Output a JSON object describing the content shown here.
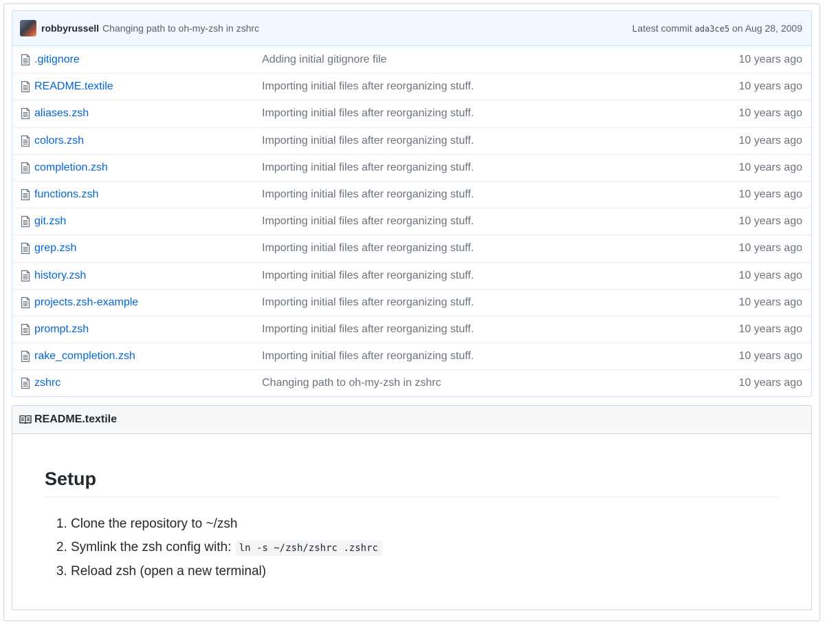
{
  "commit": {
    "author": "robbyrussell",
    "message": "Changing path to oh-my-zsh in zshrc",
    "latest_prefix": "Latest commit",
    "sha": "ada3ce5",
    "date_text": "on Aug 28, 2009"
  },
  "files": [
    {
      "name": ".gitignore",
      "message": "Adding initial gitignore file",
      "age": "10 years ago"
    },
    {
      "name": "README.textile",
      "message": "Importing initial files after reorganizing stuff.",
      "age": "10 years ago"
    },
    {
      "name": "aliases.zsh",
      "message": "Importing initial files after reorganizing stuff.",
      "age": "10 years ago"
    },
    {
      "name": "colors.zsh",
      "message": "Importing initial files after reorganizing stuff.",
      "age": "10 years ago"
    },
    {
      "name": "completion.zsh",
      "message": "Importing initial files after reorganizing stuff.",
      "age": "10 years ago"
    },
    {
      "name": "functions.zsh",
      "message": "Importing initial files after reorganizing stuff.",
      "age": "10 years ago"
    },
    {
      "name": "git.zsh",
      "message": "Importing initial files after reorganizing stuff.",
      "age": "10 years ago"
    },
    {
      "name": "grep.zsh",
      "message": "Importing initial files after reorganizing stuff.",
      "age": "10 years ago"
    },
    {
      "name": "history.zsh",
      "message": "Importing initial files after reorganizing stuff.",
      "age": "10 years ago"
    },
    {
      "name": "projects.zsh-example",
      "message": "Importing initial files after reorganizing stuff.",
      "age": "10 years ago"
    },
    {
      "name": "prompt.zsh",
      "message": "Importing initial files after reorganizing stuff.",
      "age": "10 years ago"
    },
    {
      "name": "rake_completion.zsh",
      "message": "Importing initial files after reorganizing stuff.",
      "age": "10 years ago"
    },
    {
      "name": "zshrc",
      "message": "Changing path to oh-my-zsh in zshrc",
      "age": "10 years ago"
    }
  ],
  "readme": {
    "filename": "README.textile",
    "title": "Setup",
    "steps": [
      {
        "text": "Clone the repository to ~/zsh",
        "code": ""
      },
      {
        "text": "Symlink the zsh config with: ",
        "code": "ln -s ~/zsh/zshrc .zshrc"
      },
      {
        "text": "Reload zsh (open a new terminal)",
        "code": ""
      }
    ]
  },
  "icons": {
    "file": "file-icon",
    "book": "book-icon"
  },
  "colors": {
    "link": "#0366d6",
    "muted": "#6a737d",
    "commit_bg": "#f1f8ff"
  }
}
